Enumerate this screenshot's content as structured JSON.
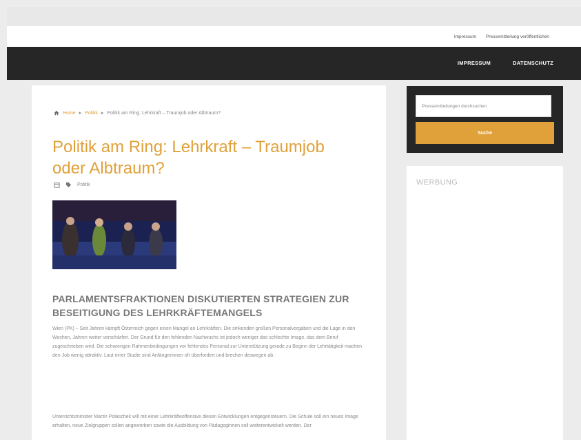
{
  "topbar": {
    "links": [
      "Impressum",
      "Pressemitteilung veröffentlichen"
    ]
  },
  "nav": {
    "items": [
      "IMPRESSUM",
      "DATENSCHUTZ"
    ]
  },
  "breadcrumb": {
    "home": "Home",
    "category": "Politik",
    "current": "Politik am Ring: Lehrkraft – Traumjob oder Albtraum?"
  },
  "article": {
    "title": "Politik am Ring: Lehrkraft – Traumjob oder Albtraum?",
    "category": "Politik",
    "subheading": "PARLAMENTSFRAKTIONEN DISKUTIERTEN STRATEGIEN ZUR BESEITIGUNG DES LEHRKRÄFTEMANGELS",
    "paragraphs": [
      "Wien (PK) – Seit Jahren kämpft Österreich gegen einen Mangel an Lehrkräften. Die sinkenden großen Personalvorgaben und die Lage in den Wochen, Jahren weiter verschärfen. Der Grund für den fehlenden Nachwuchs ist jedoch weniger das schlechte Image, das dem Beruf zugeschrieben wird. Die schwierigen Rahmenbedingungen vor fehlendes Personal zur Unterstützung gerade zu Beginn der Lehrtätigkeit machen den Job wenig attraktiv. Laut einer Studie sind Anfängerinnen oft überfordert und brechen deswegen ab.",
      "Unterrichtsminister Martin Polaschek will mit einer Lehrkräfteoffensive diesen Entwicklungen entgegensteuern. Die Schule soll ein neues Image erhalten, neue Zielgruppen sollen angeworben sowie die Ausbildung von Pädagoginnen soll weiterentwickelt werden. Der"
    ]
  },
  "sidebar": {
    "search_placeholder": "Pressemitteilungen durchsuchen",
    "search_button": "Suche",
    "ad_title": "WERBUNG"
  },
  "colors": {
    "accent": "#e0a13a",
    "nav_bg": "#262626"
  }
}
